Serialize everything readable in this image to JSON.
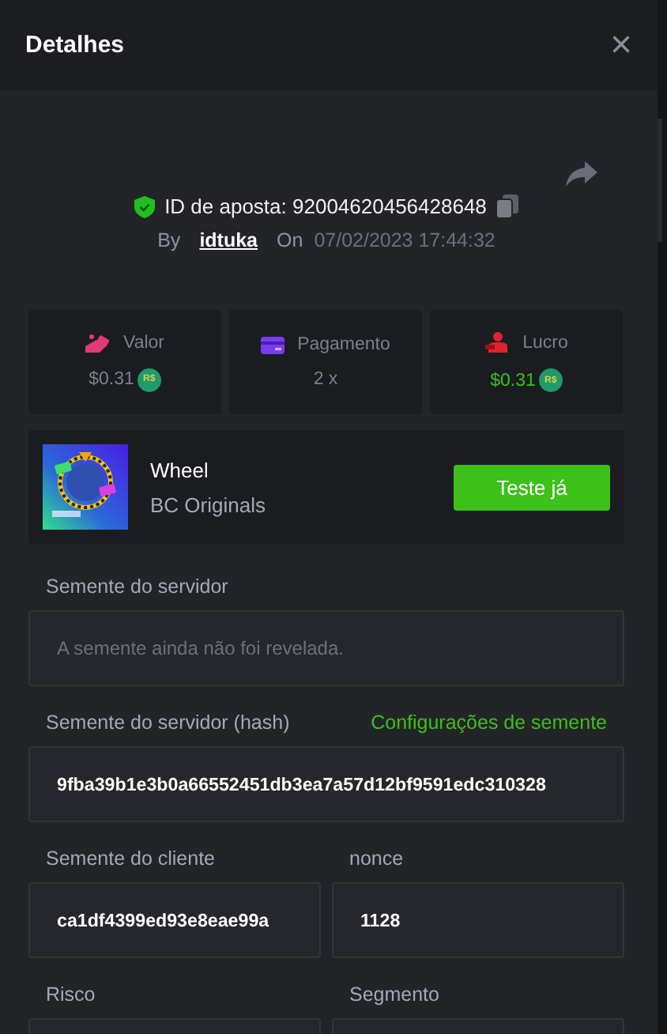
{
  "header": {
    "title": "Detalhes",
    "close": "×"
  },
  "bet": {
    "id_label": "ID de aposta: 92004620456428648",
    "verified": true,
    "by_label": "By",
    "user": "idtuka",
    "on_label": "On",
    "date": "07/02/2023 17:44:32"
  },
  "stats": [
    {
      "kind": "amount",
      "label": "Valor",
      "value": "$0.31",
      "coin": "R$"
    },
    {
      "kind": "payout",
      "label": "Pagamento",
      "value": "2 x"
    },
    {
      "kind": "profit",
      "label": "Lucro",
      "value": "$0.31",
      "coin": "R$"
    }
  ],
  "game": {
    "name": "Wheel",
    "provider": "BC Originals",
    "button": "Teste já"
  },
  "field_rows": [
    [
      {
        "label": "Semente do servidor",
        "placeholder": "A semente ainda não foi revelada."
      }
    ],
    [
      {
        "label": "Semente do servidor (hash)",
        "link": "Configurações de semente",
        "value": "9fba39b1e3b0a66552451db3ea7a57d12bf9591edc310328"
      }
    ],
    [
      {
        "label": "Semente do cliente",
        "value": "ca1df4399ed93e8eae99a"
      },
      {
        "label": "nonce",
        "value": "1128"
      }
    ],
    [
      {
        "label": "Risco"
      },
      {
        "label": "Segmento"
      }
    ]
  ]
}
